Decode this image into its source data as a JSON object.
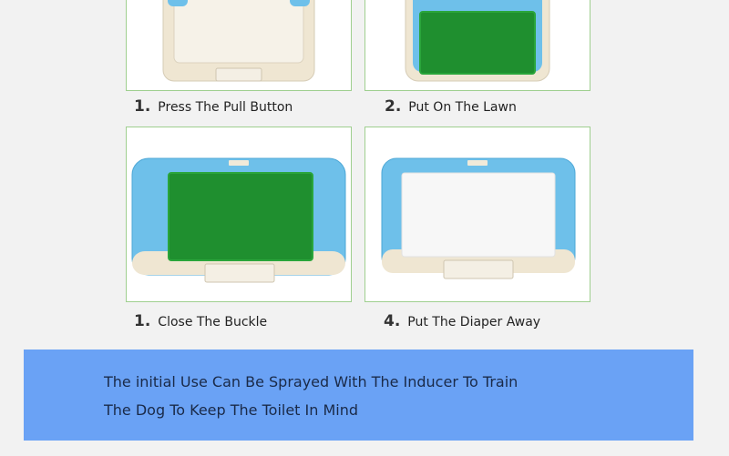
{
  "steps": [
    {
      "number": "1.",
      "label": "Press The Pull Button",
      "image": "tray-base-image"
    },
    {
      "number": "2.",
      "label": "Put On The Lawn",
      "image": "tray-lawn-image"
    },
    {
      "number": "1.",
      "label": "Close The Buckle",
      "image": "tray-buckle-lawn-image"
    },
    {
      "number": "4.",
      "label": "Put The Diaper Away",
      "image": "tray-diaper-image"
    }
  ],
  "banner": {
    "line1": "The initial Use Can Be Sprayed With The Inducer To Train",
    "line2": "The Dog To Keep The Toilet In Mind"
  },
  "colors": {
    "tray_blue": "#6ec0ea",
    "tray_cream": "#efe6d2",
    "lawn_green": "#1f8f2f",
    "diaper_white": "#f7f7f7",
    "banner_blue": "#6aa2f5",
    "panel_border": "#9fcf8f"
  }
}
